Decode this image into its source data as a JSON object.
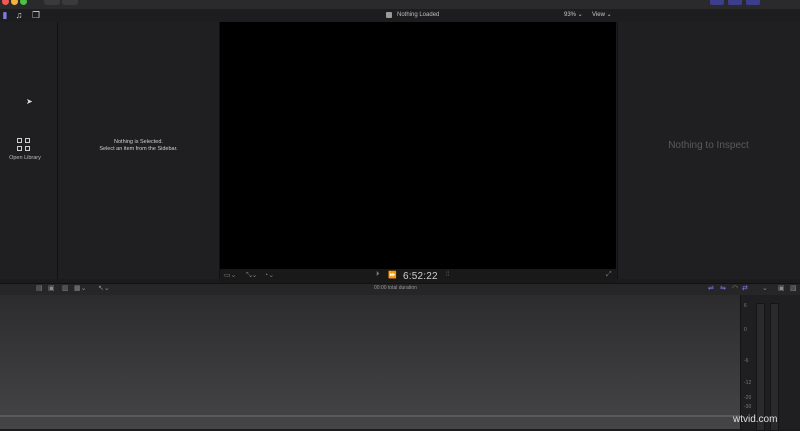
{
  "window": {
    "traffic_lights": [
      "#ee5a52",
      "#f4b43c",
      "#4fc145"
    ]
  },
  "toolbar": {
    "import_icon": "import-media-icon",
    "libraries_icon": "libraries-icon",
    "photos_icon": "photos-audio-icon",
    "titles_icon": "titles-generators-icon"
  },
  "viewer": {
    "title": "Nothing Loaded",
    "zoom": "93% ⌄",
    "view_menu": "View ⌄",
    "timecode": "6:52:22"
  },
  "sidebar": {
    "open_library_label": "Open Library"
  },
  "browser": {
    "line1": "Nothing is Selected.",
    "line2": "Select an item from the Sidebar."
  },
  "inspector": {
    "message": "Nothing to Inspect"
  },
  "timeline": {
    "total_duration": "00:00 total duration"
  },
  "meters": {
    "ticks": [
      "6",
      "0",
      "-6",
      "-12",
      "-20",
      "-30"
    ]
  },
  "watermark": "wtvid.com",
  "colors": {
    "accent": "#7d7de8",
    "background": "#1b1b1d",
    "viewer": "#000000"
  }
}
